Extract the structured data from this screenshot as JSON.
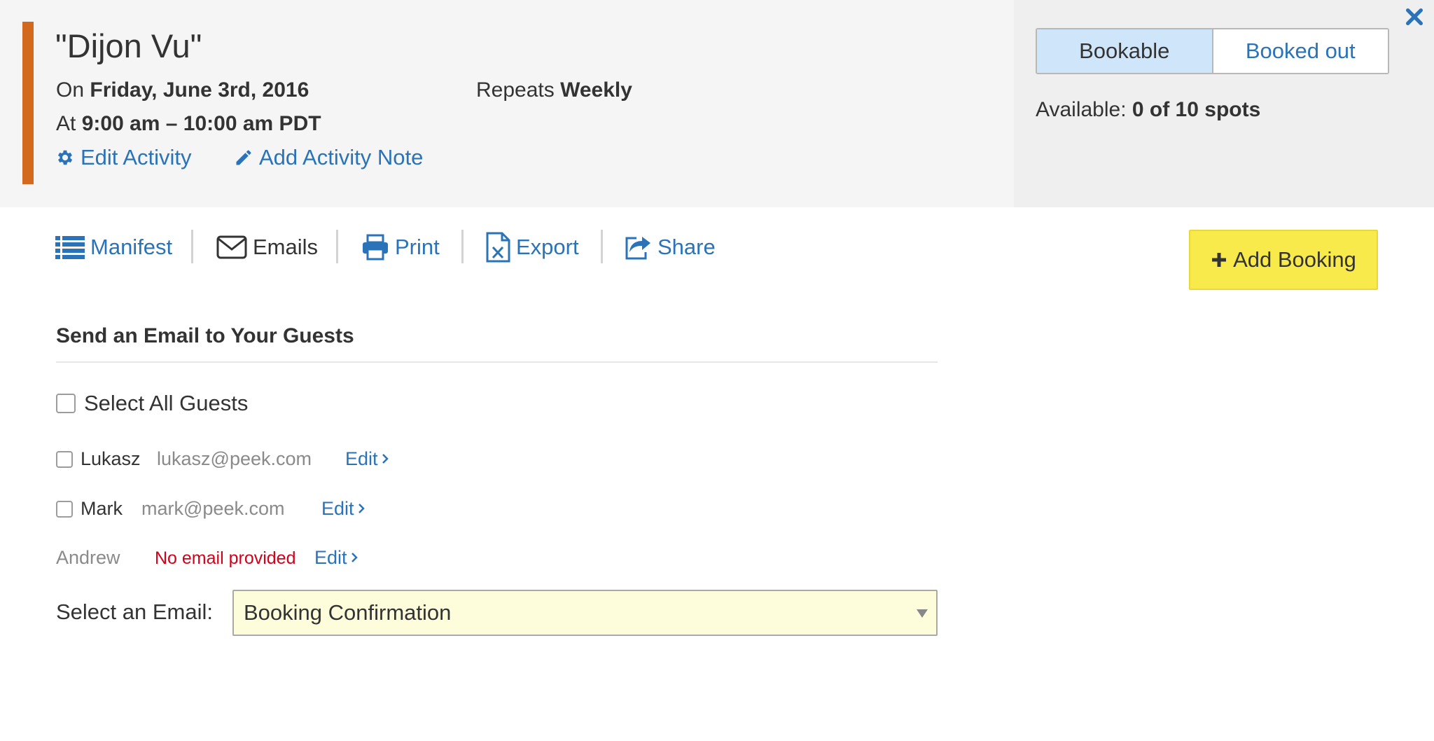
{
  "header": {
    "title": "\"Dijon Vu\"",
    "date_prefix": "On",
    "date_value": "Friday, June 3rd, 2016",
    "repeats_prefix": "Repeats",
    "repeats_value": "Weekly",
    "time_prefix": "At",
    "time_value": "9:00 am – 10:00 am PDT",
    "edit_activity_label": "Edit Activity",
    "add_note_label": "Add Activity Note",
    "accent_color": "#d2691e"
  },
  "availability": {
    "toggle_options": [
      "Bookable",
      "Booked out"
    ],
    "selected": "Bookable",
    "available_prefix": "Available:",
    "available_value": "0 of 10 spots"
  },
  "tabs": [
    {
      "label": "Manifest",
      "icon": "list-icon"
    },
    {
      "label": "Emails",
      "icon": "envelope-icon"
    },
    {
      "label": "Print",
      "icon": "printer-icon"
    },
    {
      "label": "Export",
      "icon": "excel-file-icon"
    },
    {
      "label": "Share",
      "icon": "share-icon"
    }
  ],
  "active_tab": "Emails",
  "add_booking_label": "Add Booking",
  "email_section": {
    "title": "Send an Email to Your Guests",
    "select_all_label": "Select All Guests",
    "guests": [
      {
        "name": "Lukasz",
        "email": "lukasz@peek.com",
        "edit_label": "Edit",
        "has_checkbox": true
      },
      {
        "name": "Mark",
        "email": "mark@peek.com",
        "edit_label": "Edit",
        "has_checkbox": true
      },
      {
        "name": "Andrew",
        "email": "No email provided",
        "edit_label": "Edit",
        "has_checkbox": false
      }
    ],
    "select_email_label": "Select an Email:",
    "selected_email": "Booking Confirmation"
  },
  "colors": {
    "link": "#2a73b8",
    "add_booking_bg": "#f7ea4a",
    "select_bg": "#fdfddc",
    "toggle_selected_bg": "#cfe6fa",
    "error_text": "#d0021b"
  }
}
